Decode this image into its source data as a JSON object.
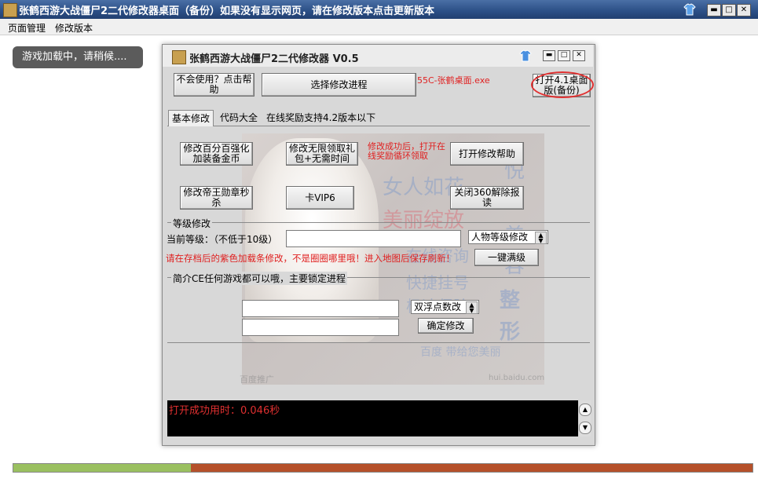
{
  "window": {
    "title": "张鹤西游大战僵尸2二代修改器桌面（备份）如果没有显示网页，请在修改版本点击更新版本",
    "min": "▬",
    "max": "□",
    "close": "✕"
  },
  "menu": {
    "items": [
      "页面管理",
      "修改版本"
    ]
  },
  "loading_text": "游戏加载中，请稍候....",
  "progress": {
    "percent": 24
  },
  "dialog": {
    "title": "张鹤西游大战僵尸2二代修改器 V0.5",
    "buttons": {
      "help": "不会使用？点击帮助",
      "select_process": "选择修改进程",
      "open_41": "打开4.1桌面版(备份)"
    },
    "process_label": "55C-张鹤桌面.exe",
    "tabs": [
      "基本修改",
      "代码大全",
      "在线奖励支持4.2版本以下"
    ],
    "basic": {
      "btn1": "修改百分百强化加装备金币",
      "btn2": "修改无限领取礼包+无需时间",
      "note": "修改成功后，打开在线奖励循环领取",
      "btn3": "打开修改帮助",
      "btn4": "修改帝王勋章秒杀",
      "btn5": "卡VIP6",
      "btn6": "关闭360解除报读"
    },
    "level": {
      "group": "等级修改",
      "label": "当前等级：（不低于10级）",
      "value": "",
      "select": "人物等级修改",
      "warning": "请在存档后的紫色加载条修改，不是圈圈哪里哦！进入地图后保存刷新！",
      "button": "一键满级"
    },
    "ce": {
      "group": "简介CE任何游戏都可以哦，主要锁定进程",
      "input1": "",
      "input2": "",
      "select": "双浮点数改",
      "button": "确定修改"
    },
    "watermark": {
      "w1": "女人如花",
      "w2": "美丽绽放",
      "w3": "在线咨询",
      "w4": "快捷挂号",
      "w5": "极速保险",
      "w6": "悦",
      "w7": "美",
      "w8": "容",
      "w9": "整",
      "w10": "形",
      "w11": "百度 带给您美丽",
      "w12": "百度推广",
      "w13": "hui.baidu.com"
    },
    "log": "打开成功用时：0.046秒"
  },
  "colors": {
    "accent_red": "#e02020",
    "title_bar": "#2b4f86",
    "progress_fill": "#9ac060",
    "progress_track": "#b5502a"
  }
}
